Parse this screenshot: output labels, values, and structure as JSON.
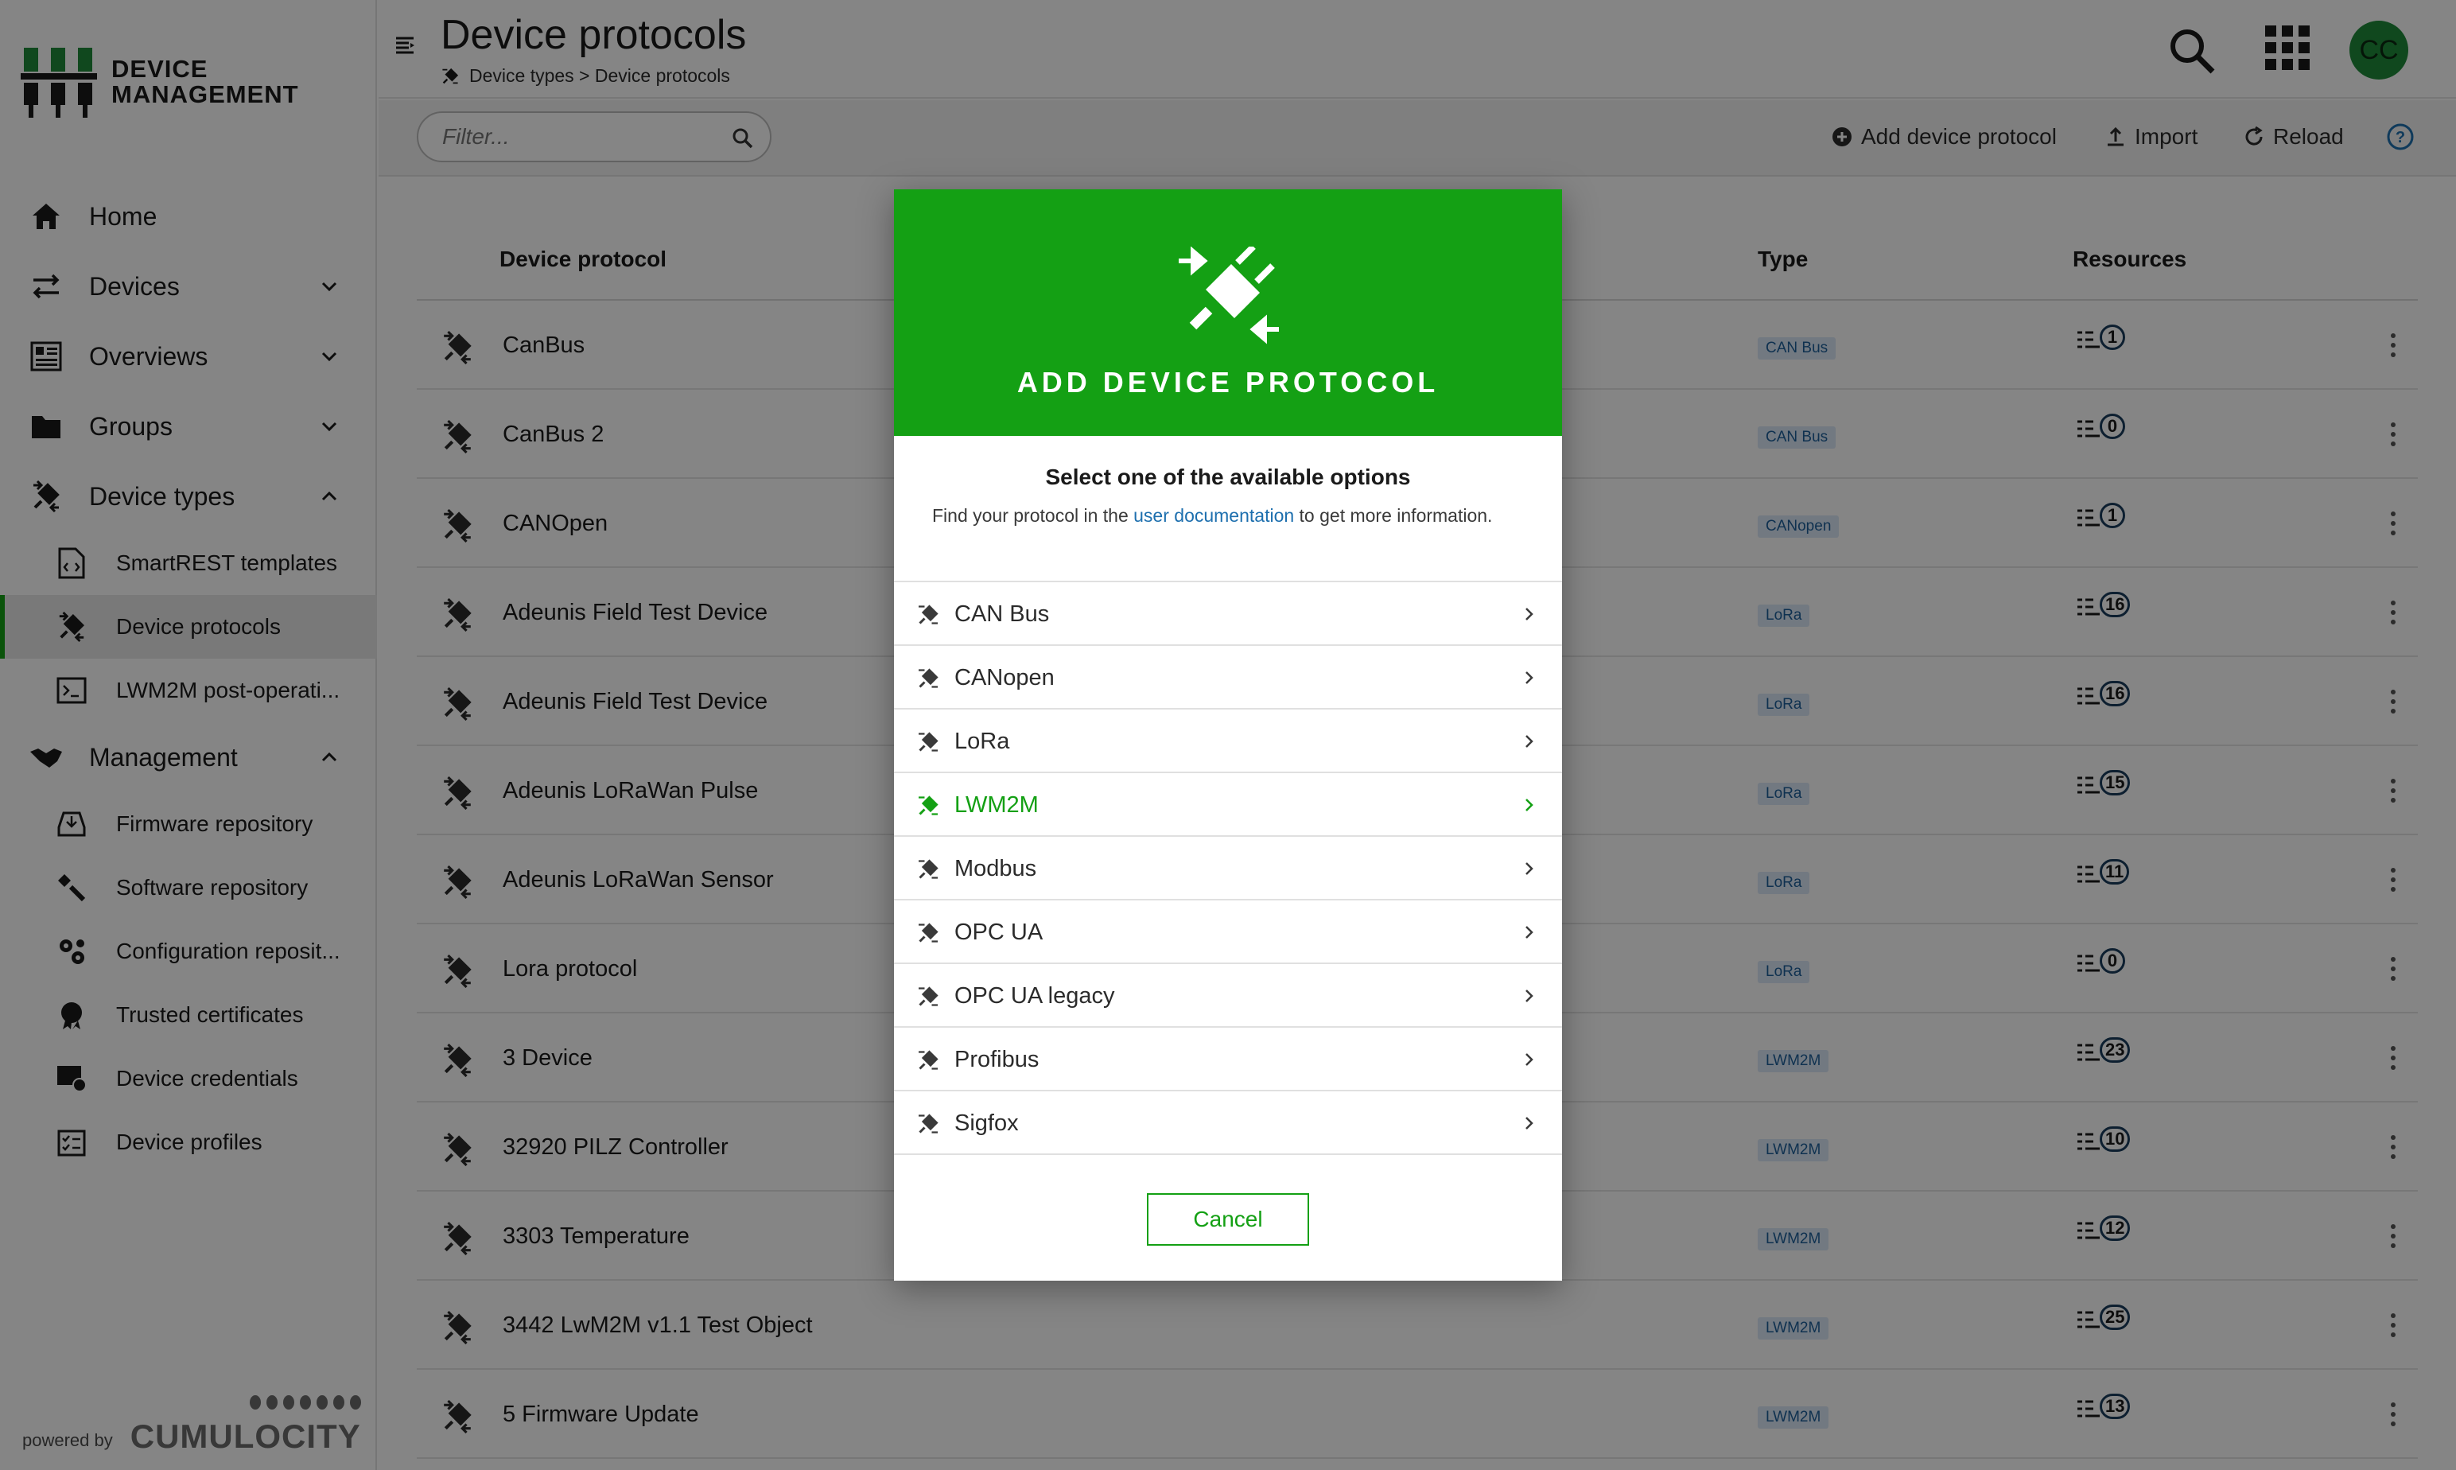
{
  "brand": {
    "line1": "DEVICE",
    "line2": "MANAGEMENT"
  },
  "sidebar": {
    "home": "Home",
    "devices": "Devices",
    "overviews": "Overviews",
    "groups": "Groups",
    "device_types": "Device types",
    "device_types_items": [
      "SmartREST templates",
      "Device protocols",
      "LWM2M post-operati..."
    ],
    "management": "Management",
    "management_items": [
      "Firmware repository",
      "Software repository",
      "Configuration reposit...",
      "Trusted certificates",
      "Device credentials",
      "Device profiles"
    ],
    "powered_by": "powered by",
    "footer_logo": "CUMULOCITY"
  },
  "header": {
    "title": "Device protocols",
    "breadcrumb": "Device types > Device protocols",
    "avatar": "CC"
  },
  "toolbar": {
    "filter_placeholder": "Filter...",
    "add": "Add device protocol",
    "import": "Import",
    "reload": "Reload"
  },
  "table": {
    "columns": {
      "protocol": "Device protocol",
      "type": "Type",
      "resources": "Resources"
    },
    "rows": [
      {
        "name": "CanBus",
        "type": "CAN Bus",
        "resources": "1"
      },
      {
        "name": "CanBus 2",
        "type": "CAN Bus",
        "resources": "0"
      },
      {
        "name": "CANOpen",
        "type": "CANopen",
        "resources": "1"
      },
      {
        "name": "Adeunis Field Test Device",
        "type": "LoRa",
        "resources": "16"
      },
      {
        "name": "Adeunis Field Test Device",
        "type": "LoRa",
        "resources": "16"
      },
      {
        "name": "Adeunis LoRaWan Pulse",
        "type": "LoRa",
        "resources": "15"
      },
      {
        "name": "Adeunis LoRaWan Sensor",
        "type": "LoRa",
        "resources": "11"
      },
      {
        "name": "Lora protocol",
        "type": "LoRa",
        "resources": "0"
      },
      {
        "name": "3 Device",
        "type": "LWM2M",
        "resources": "23"
      },
      {
        "name": "32920 PILZ Controller",
        "type": "LWM2M",
        "resources": "10"
      },
      {
        "name": "3303 Temperature",
        "type": "LWM2M",
        "resources": "12"
      },
      {
        "name": "3442 LwM2M v1.1 Test Object",
        "type": "LWM2M",
        "resources": "25"
      },
      {
        "name": "5 Firmware Update",
        "type": "LWM2M",
        "resources": "13"
      }
    ]
  },
  "modal": {
    "title": "ADD DEVICE PROTOCOL",
    "heading": "Select one of the available options",
    "intro_pre": "Find your protocol in the ",
    "intro_link": "user documentation",
    "intro_post": " to get more information.",
    "options": [
      "CAN Bus",
      "CANopen",
      "LoRa",
      "LWM2M",
      "Modbus",
      "OPC UA",
      "OPC UA legacy",
      "Profibus",
      "Sigfox"
    ],
    "highlighted": "LWM2M",
    "cancel": "Cancel"
  },
  "colors": {
    "accent": "#14a014",
    "link": "#1d6fae",
    "badge_bg": "#dbe9f7"
  }
}
